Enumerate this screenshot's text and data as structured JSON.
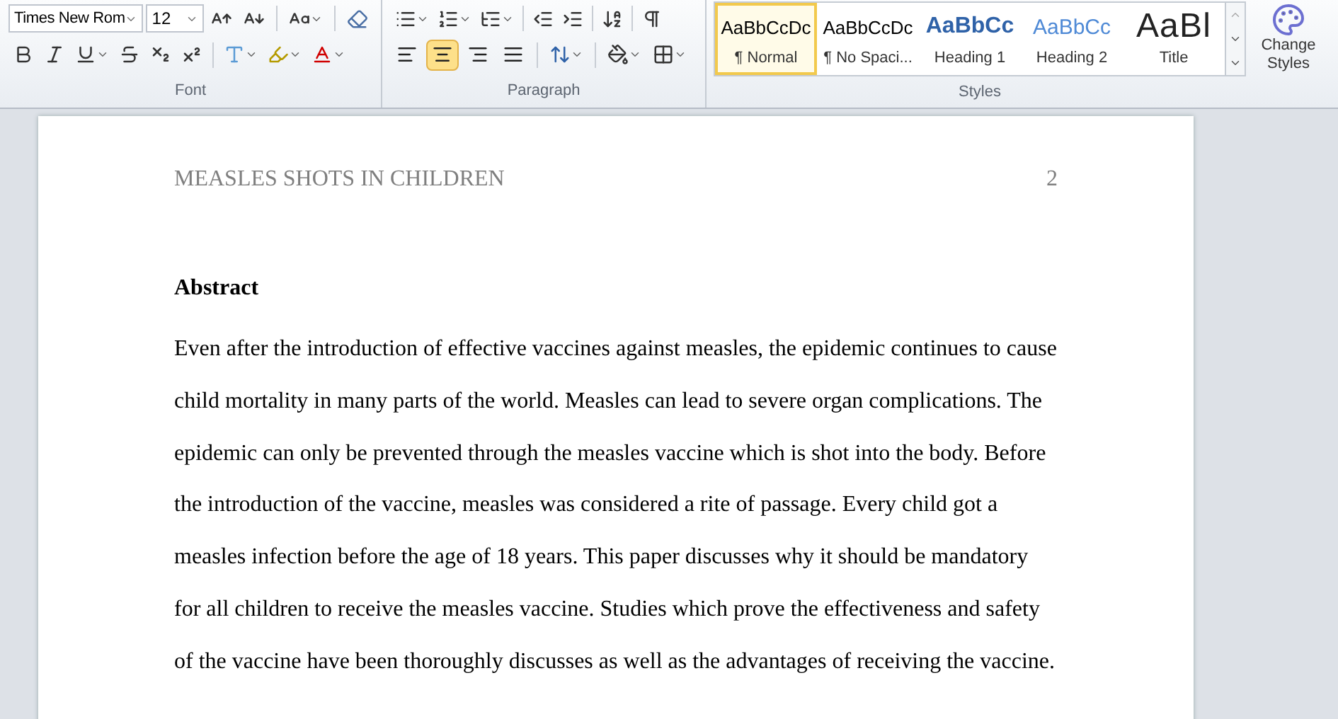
{
  "ribbon": {
    "font": {
      "font_name": "Times New Rom",
      "font_size": "12",
      "label": "Font"
    },
    "paragraph": {
      "label": "Paragraph",
      "alignments": [
        {
          "kind": "left",
          "selected": false
        },
        {
          "kind": "center",
          "selected": true
        },
        {
          "kind": "right",
          "selected": false
        },
        {
          "kind": "justify",
          "selected": false
        }
      ]
    },
    "styles": {
      "label": "Styles",
      "items": [
        {
          "preview": "AaBbCcDc",
          "name": "¶ Normal",
          "kind": "normal",
          "selected": true
        },
        {
          "preview": "AaBbCcDc",
          "name": "¶ No Spaci...",
          "kind": "normal",
          "selected": false
        },
        {
          "preview": "AaBbCc",
          "name": "Heading 1",
          "kind": "heading1",
          "selected": false
        },
        {
          "preview": "AaBbCc",
          "name": "Heading 2",
          "kind": "heading2",
          "selected": false
        },
        {
          "preview": "AaBl",
          "name": "Title",
          "kind": "title",
          "selected": false
        }
      ],
      "change_styles": [
        "Change",
        "Styles"
      ]
    }
  },
  "document": {
    "header": "MEASLES SHOTS IN CHILDREN",
    "page_number": "2",
    "heading": "Abstract",
    "lines": [
      "Even after the introduction of effective vaccines against measles, the epidemic continues to cause",
      "child mortality in many parts of the world. Measles can lead to severe organ complications. The",
      "epidemic can only be prevented through the measles vaccine which is shot into the body. Before",
      "the introduction of the vaccine, measles was considered a rite of passage. Every child got a",
      "measles infection before the age of 18 years. This paper discusses why it should be mandatory",
      "for all children to receive the measles vaccine. Studies which prove the effectiveness and safety",
      "of the vaccine have been thoroughly discusses as well as the advantages of receiving the vaccine."
    ]
  }
}
